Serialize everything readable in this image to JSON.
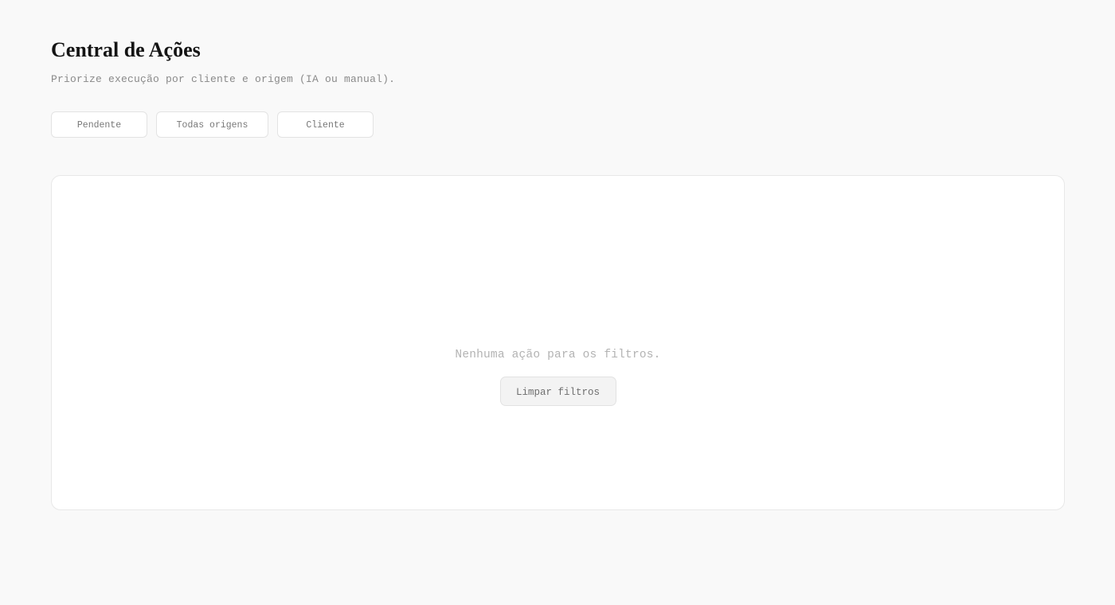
{
  "header": {
    "title": "Central de Ações",
    "subtitle": "Priorize execução por cliente e origem (IA ou manual)."
  },
  "filters": {
    "status_label": "Pendente",
    "origin_label": "Todas origens",
    "client_label": "Cliente"
  },
  "empty_state": {
    "message": "Nenhuma ação para os filtros.",
    "clear_label": "Limpar filtros"
  },
  "colors": {
    "background": "#f9f9f9",
    "panel": "#ffffff",
    "border": "#e8e8e8",
    "muted_text": "#b3b3b3"
  }
}
